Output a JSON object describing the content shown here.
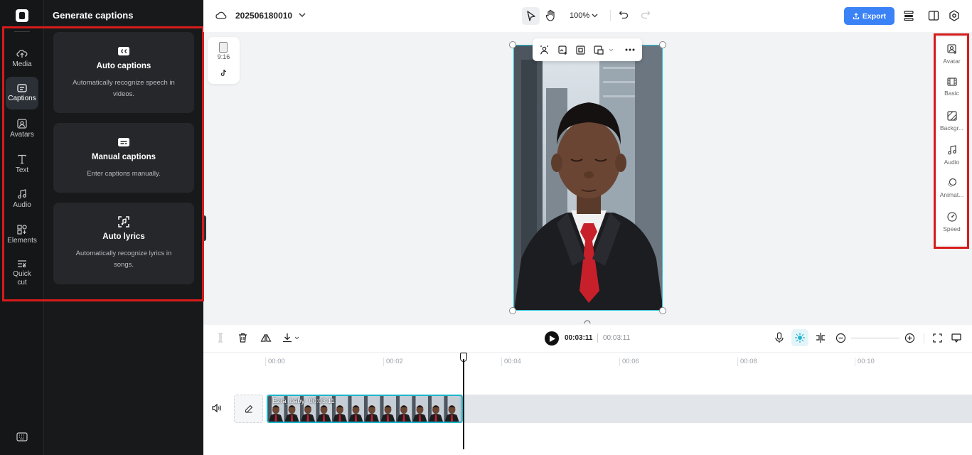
{
  "left_rail": {
    "items": [
      {
        "label": "Media",
        "icon": "cloud-upload-icon"
      },
      {
        "label": "Captions",
        "icon": "captions-icon"
      },
      {
        "label": "Avatars",
        "icon": "avatar-icon"
      },
      {
        "label": "Text",
        "icon": "text-icon"
      },
      {
        "label": "Audio",
        "icon": "music-note-icon"
      },
      {
        "label": "Elements",
        "icon": "elements-icon"
      },
      {
        "label": "Quick cut",
        "icon": "quick-cut-icon"
      }
    ],
    "active": "Captions"
  },
  "panel": {
    "title": "Generate captions",
    "cards": [
      {
        "title": "Auto captions",
        "desc": "Automatically recognize speech in videos.",
        "icon": "cc-icon"
      },
      {
        "title": "Manual captions",
        "desc": "Enter captions manually.",
        "icon": "subtitle-icon"
      },
      {
        "title": "Auto lyrics",
        "desc": "Automatically recognize lyrics in songs.",
        "icon": "lyrics-icon"
      }
    ]
  },
  "topbar": {
    "project_name": "202506180010",
    "zoom": "100%",
    "export_label": "Export"
  },
  "canvas": {
    "ratio_label": "9:16"
  },
  "right_panel": {
    "items": [
      {
        "label": "Avatar",
        "icon": "avatar-add-icon"
      },
      {
        "label": "Basic",
        "icon": "film-icon"
      },
      {
        "label": "Backgr...",
        "icon": "background-icon"
      },
      {
        "label": "Audio",
        "icon": "music-note-icon"
      },
      {
        "label": "Animat...",
        "icon": "animation-icon"
      },
      {
        "label": "Speed",
        "icon": "speed-icon"
      }
    ]
  },
  "timeline": {
    "current_time": "00:03:11",
    "total_time": "00:03:11",
    "ticks": [
      "00:00",
      "00:02",
      "00:04",
      "00:06",
      "00:08",
      "00:10"
    ],
    "clip_label": "Ezra_baby",
    "clip_duration": "00:03:11"
  },
  "colors": {
    "accent": "#3b82f6",
    "selection": "#23c3d8",
    "highlight_box": "#d71b1b"
  }
}
